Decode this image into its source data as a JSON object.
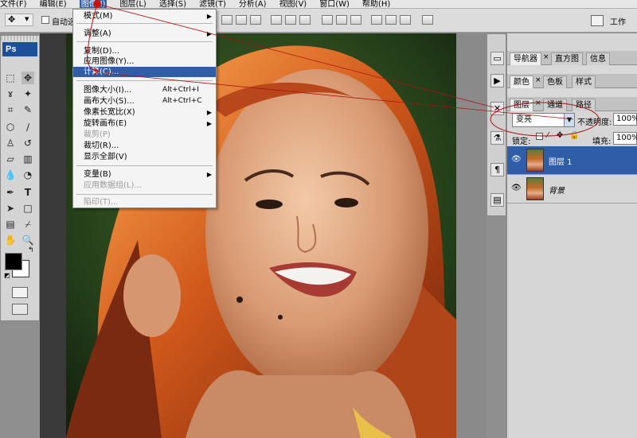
{
  "menubar": {
    "items": [
      "文件(F)",
      "编辑(E)",
      "图像(I)",
      "图层(L)",
      "选择(S)",
      "滤镜(T)",
      "分析(A)",
      "视图(V)",
      "窗口(W)",
      "帮助(H)"
    ],
    "active_index": 2
  },
  "optionsbar": {
    "auto_select_label": "自动选",
    "workspace_label": "工作"
  },
  "tools": {
    "brand": "Ps"
  },
  "image_menu": {
    "items": [
      {
        "label": "模式(M)",
        "shortcut": "",
        "submenu": true,
        "disabled": false,
        "highlight": false
      },
      {
        "label": "调整(A)",
        "shortcut": "",
        "submenu": true,
        "disabled": false,
        "highlight": false
      },
      {
        "label": "复制(D)...",
        "shortcut": "",
        "submenu": false,
        "disabled": false,
        "highlight": false
      },
      {
        "label": "应用图像(Y)...",
        "shortcut": "",
        "submenu": false,
        "disabled": false,
        "highlight": false
      },
      {
        "label": "计算(C)...",
        "shortcut": "",
        "submenu": false,
        "disabled": false,
        "highlight": true
      },
      {
        "label": "图像大小(I)...",
        "shortcut": "Alt+Ctrl+I",
        "submenu": false,
        "disabled": false,
        "highlight": false
      },
      {
        "label": "画布大小(S)...",
        "shortcut": "Alt+Ctrl+C",
        "submenu": false,
        "disabled": false,
        "highlight": false
      },
      {
        "label": "像素长宽比(X)",
        "shortcut": "",
        "submenu": true,
        "disabled": false,
        "highlight": false
      },
      {
        "label": "旋转画布(E)",
        "shortcut": "",
        "submenu": true,
        "disabled": false,
        "highlight": false
      },
      {
        "label": "裁剪(P)",
        "shortcut": "",
        "submenu": false,
        "disabled": true,
        "highlight": false
      },
      {
        "label": "裁切(R)...",
        "shortcut": "",
        "submenu": false,
        "disabled": false,
        "highlight": false
      },
      {
        "label": "显示全部(V)",
        "shortcut": "",
        "submenu": false,
        "disabled": false,
        "highlight": false
      },
      {
        "label": "变量(B)",
        "shortcut": "",
        "submenu": true,
        "disabled": false,
        "highlight": false
      },
      {
        "label": "应用数据组(L)...",
        "shortcut": "",
        "submenu": false,
        "disabled": true,
        "highlight": false
      },
      {
        "label": "陷印(T)...",
        "shortcut": "",
        "submenu": false,
        "disabled": true,
        "highlight": false
      }
    ]
  },
  "panels": {
    "nav_tabs": [
      "导航器",
      "直方图",
      "信息"
    ],
    "color_tabs": [
      "颜色",
      "色板",
      "样式"
    ],
    "layer_tabs": [
      "图层",
      "通道",
      "路径"
    ],
    "blend_mode": "变亮",
    "opacity_label": "不透明度:",
    "opacity_value": "100%",
    "lock_label": "锁定:",
    "fill_label": "填充:",
    "fill_value": "100%",
    "layers": [
      {
        "name": "图层 1",
        "selected": true,
        "italic": false
      },
      {
        "name": "背景",
        "selected": false,
        "italic": true
      }
    ]
  },
  "colors": {
    "highlight": "#2f5da8",
    "annotation": "#cc1111"
  }
}
